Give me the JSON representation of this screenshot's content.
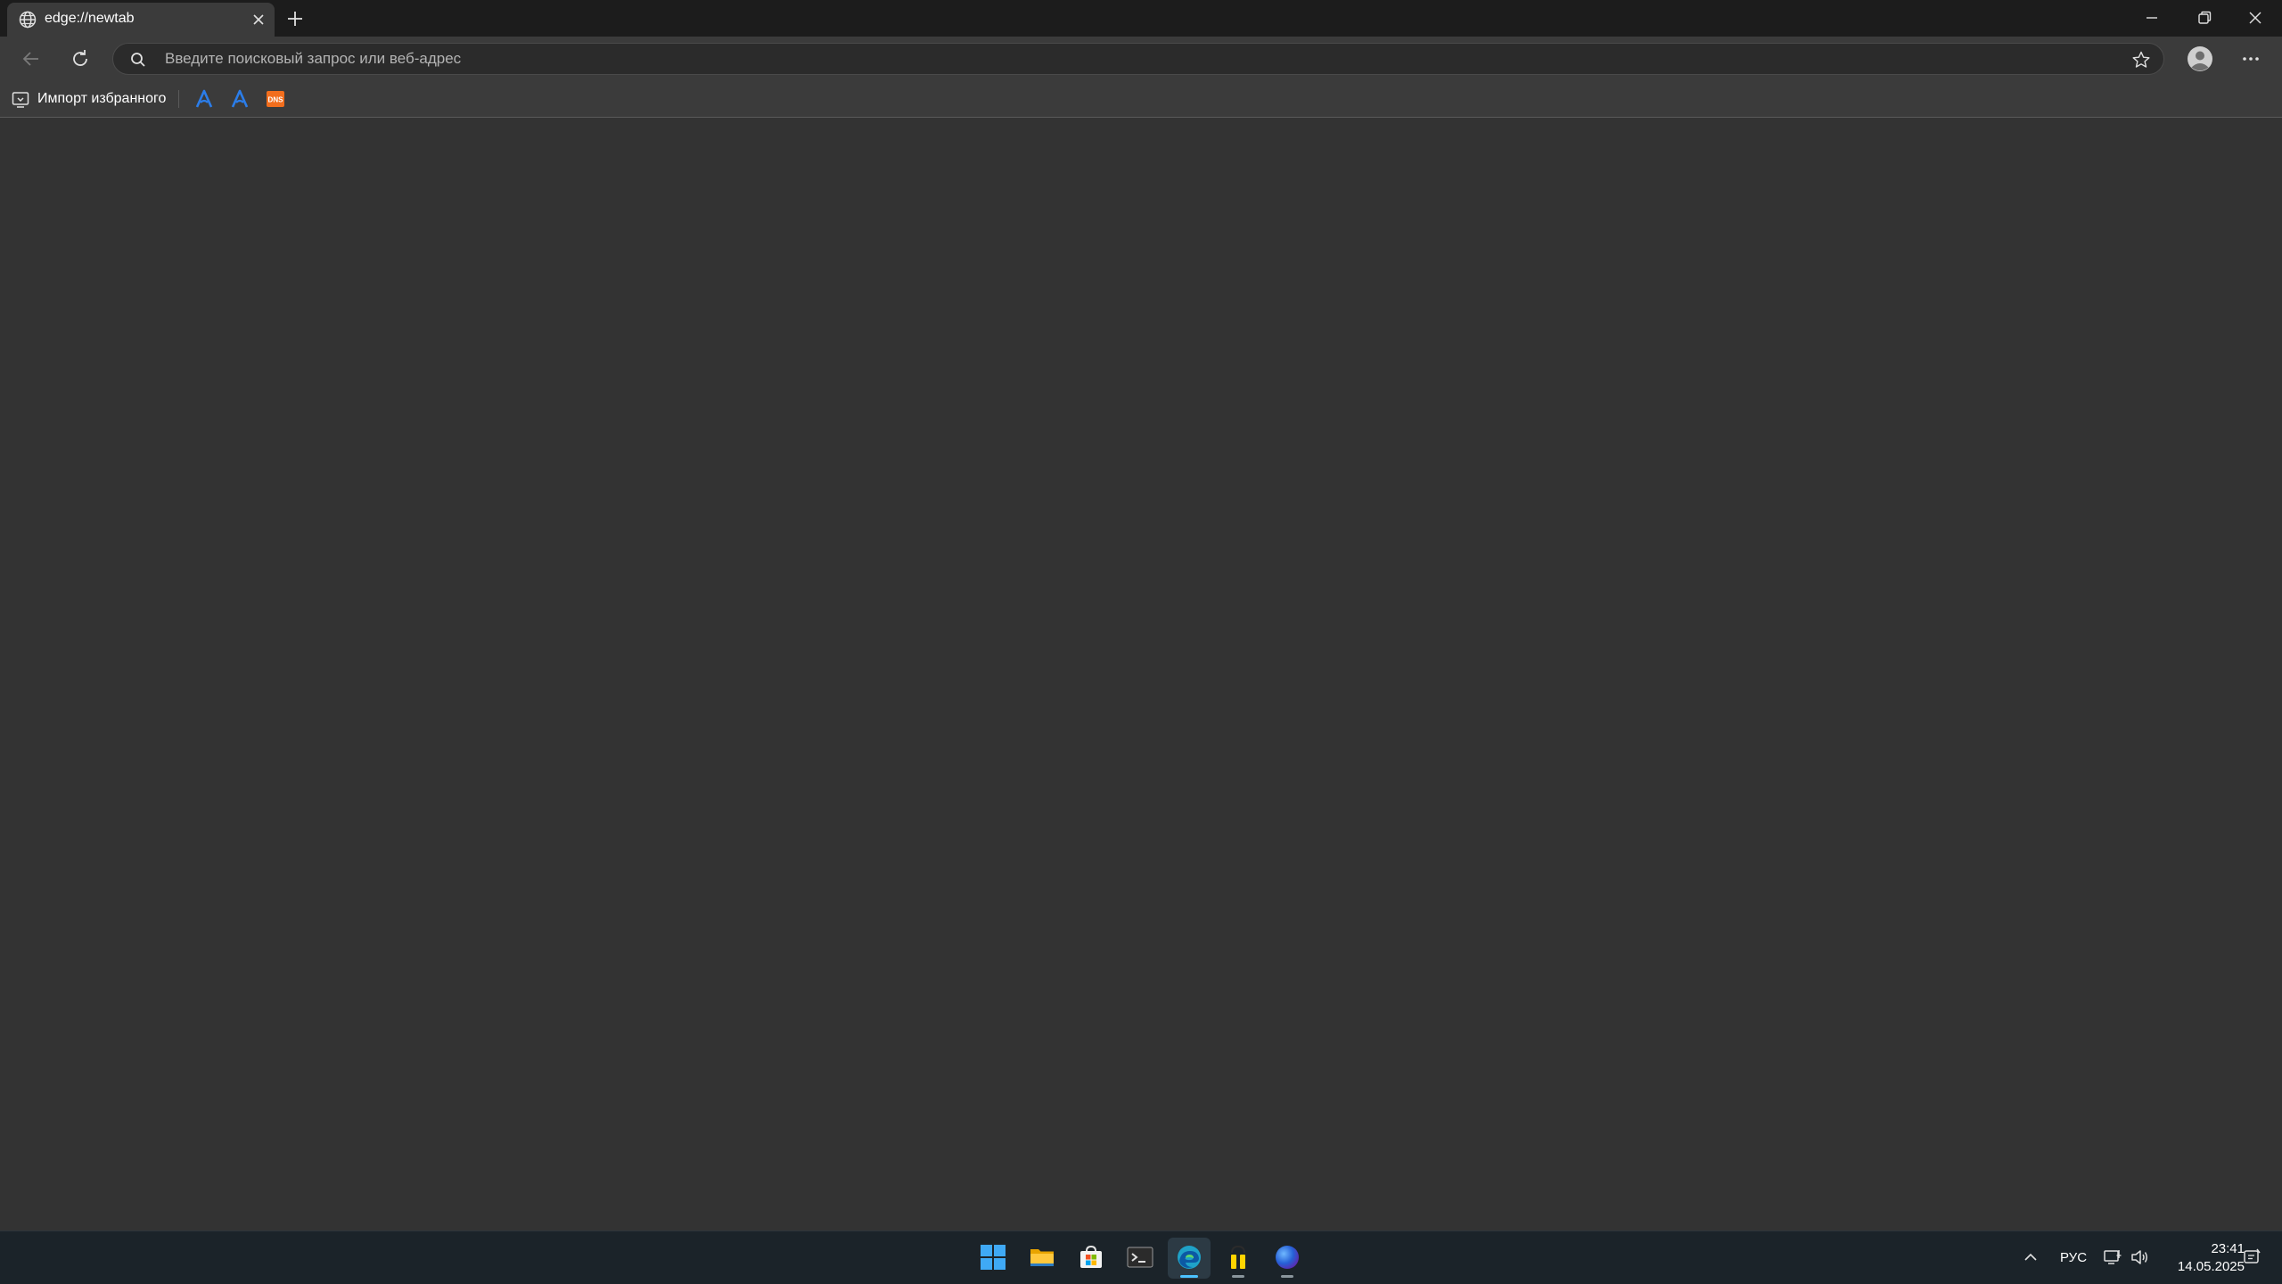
{
  "browser": {
    "tab": {
      "title": "edge://newtab",
      "icon": "globe-icon"
    },
    "address_bar": {
      "value": "",
      "placeholder": "Введите поисковый запрос или веб-адрес"
    },
    "bookmarks_bar": {
      "import_label": "Импорт избранного",
      "favorites": [
        {
          "icon": "blue-a-logo-icon",
          "color": "#2b7de9"
        },
        {
          "icon": "blue-a-logo-icon",
          "color": "#2b7de9"
        },
        {
          "icon": "dns-logo-icon",
          "text": "DNS",
          "color": "#f26e1d"
        }
      ]
    },
    "theme": {
      "frame": "#1c1c1c",
      "toolbar": "#3b3b3b",
      "page": "#333333",
      "accent": "#4cc2ff"
    }
  },
  "taskbar": {
    "apps": [
      {
        "name": "start",
        "icon": "windows-start-icon",
        "active": false,
        "running": false
      },
      {
        "name": "file-explorer",
        "icon": "folder-icon",
        "active": false,
        "running": false
      },
      {
        "name": "microsoft-store",
        "icon": "store-icon",
        "active": false,
        "running": false
      },
      {
        "name": "terminal",
        "icon": "terminal-icon",
        "active": false,
        "running": false
      },
      {
        "name": "edge",
        "icon": "edge-icon",
        "active": true,
        "running": true
      },
      {
        "name": "app-yellow",
        "icon": "yellow-bars-icon",
        "active": false,
        "running": true
      },
      {
        "name": "app-blue-globe",
        "icon": "blue-orb-icon",
        "active": false,
        "running": true
      }
    ],
    "tray": {
      "language": "РУС",
      "time": "23:41",
      "date": "14.05.2025"
    }
  }
}
